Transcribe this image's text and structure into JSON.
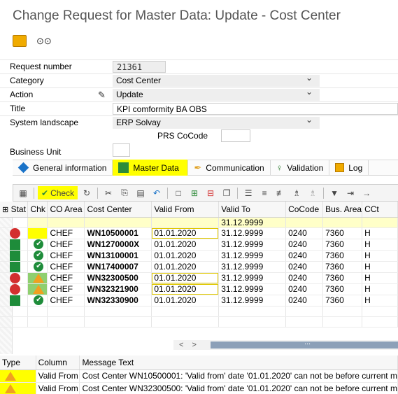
{
  "window": {
    "title": "Change Request for Master Data: Update - Cost Center"
  },
  "top_tools": {
    "icons": [
      "orange-box-icon",
      "glasses-icon"
    ]
  },
  "form": {
    "request_number_label": "Request number",
    "request_number_value": "21361",
    "category_label": "Category",
    "category_value": "Cost Center",
    "action_label": "Action",
    "action_value": "Update",
    "title_label": "Title",
    "title_value": "KPI comformity BA OBS",
    "system_landscape_label": "System landscape",
    "system_landscape_value": "ERP Solvay",
    "prs_cocode_label": "PRS CoCode",
    "prs_cocode_value": "",
    "business_unit_label": "Business Unit",
    "business_unit_value": ""
  },
  "tabs": [
    {
      "label": "General information",
      "icon": "blue-diamond-icon",
      "active": false
    },
    {
      "label": "Master Data",
      "icon": "green-square-icon",
      "active": true
    },
    {
      "label": "Communication",
      "icon": "communication-icon",
      "active": false
    },
    {
      "label": "Validation",
      "icon": "validation-icon",
      "active": false
    },
    {
      "label": "Log",
      "icon": "log-icon",
      "active": false
    }
  ],
  "grid_toolbar": {
    "check_label": "Check"
  },
  "grid": {
    "columns": [
      "Stat",
      "Chk",
      "CO Area",
      "Cost Center",
      "Valid From",
      "Valid To",
      "CoCode",
      "Bus. Area",
      "CCt"
    ],
    "default_row": {
      "valid_to": "31.12.9999"
    },
    "rows": [
      {
        "stat": "red",
        "chk": "yellow",
        "co_area": "CHEF",
        "cost_center": "WN10500001",
        "valid_from": "01.01.2020",
        "valid_to": "31.12.9999",
        "cocode": "0240",
        "bus_area": "7360",
        "cct": "H"
      },
      {
        "stat": "green",
        "chk": "ok",
        "co_area": "CHEF",
        "cost_center": "WN1270000X",
        "valid_from": "01.01.2020",
        "valid_to": "31.12.9999",
        "cocode": "0240",
        "bus_area": "7360",
        "cct": "H"
      },
      {
        "stat": "green",
        "chk": "ok",
        "co_area": "CHEF",
        "cost_center": "WN13100001",
        "valid_from": "01.01.2020",
        "valid_to": "31.12.9999",
        "cocode": "0240",
        "bus_area": "7360",
        "cct": "H"
      },
      {
        "stat": "green",
        "chk": "ok",
        "co_area": "CHEF",
        "cost_center": "WN17400007",
        "valid_from": "01.01.2020",
        "valid_to": "31.12.9999",
        "cocode": "0240",
        "bus_area": "7360",
        "cct": "H"
      },
      {
        "stat": "red",
        "chk": "warning",
        "co_area": "CHEF",
        "cost_center": "WN32300500",
        "valid_from": "01.01.2020",
        "valid_to": "31.12.9999",
        "cocode": "0240",
        "bus_area": "7360",
        "cct": "H"
      },
      {
        "stat": "red",
        "chk": "warning",
        "co_area": "CHEF",
        "cost_center": "WN32321900",
        "valid_from": "01.01.2020",
        "valid_to": "31.12.9999",
        "cocode": "0240",
        "bus_area": "7360",
        "cct": "H"
      },
      {
        "stat": "green",
        "chk": "ok",
        "co_area": "CHEF",
        "cost_center": "WN32330900",
        "valid_from": "01.01.2020",
        "valid_to": "31.12.9999",
        "cocode": "0240",
        "bus_area": "7360",
        "cct": "H"
      }
    ]
  },
  "scroll": {
    "left": "<",
    "right": ">",
    "thumb": "..."
  },
  "messages": {
    "columns": [
      "Type",
      "Column",
      "Message Text"
    ],
    "rows": [
      {
        "type": "warning",
        "column": "Valid From",
        "text": "Cost Center WN10500001: 'Valid from' date '01.01.2020' can not be before current m"
      },
      {
        "type": "warning",
        "column": "Valid From",
        "text": "Cost Center WN32300500: 'Valid from' date '01.01.2020' can not be before current m"
      }
    ]
  },
  "colors": {
    "highlight": "#ffff00",
    "error": "#d32f2f",
    "ok": "#1e8c3a",
    "warning": "#f0a020"
  }
}
